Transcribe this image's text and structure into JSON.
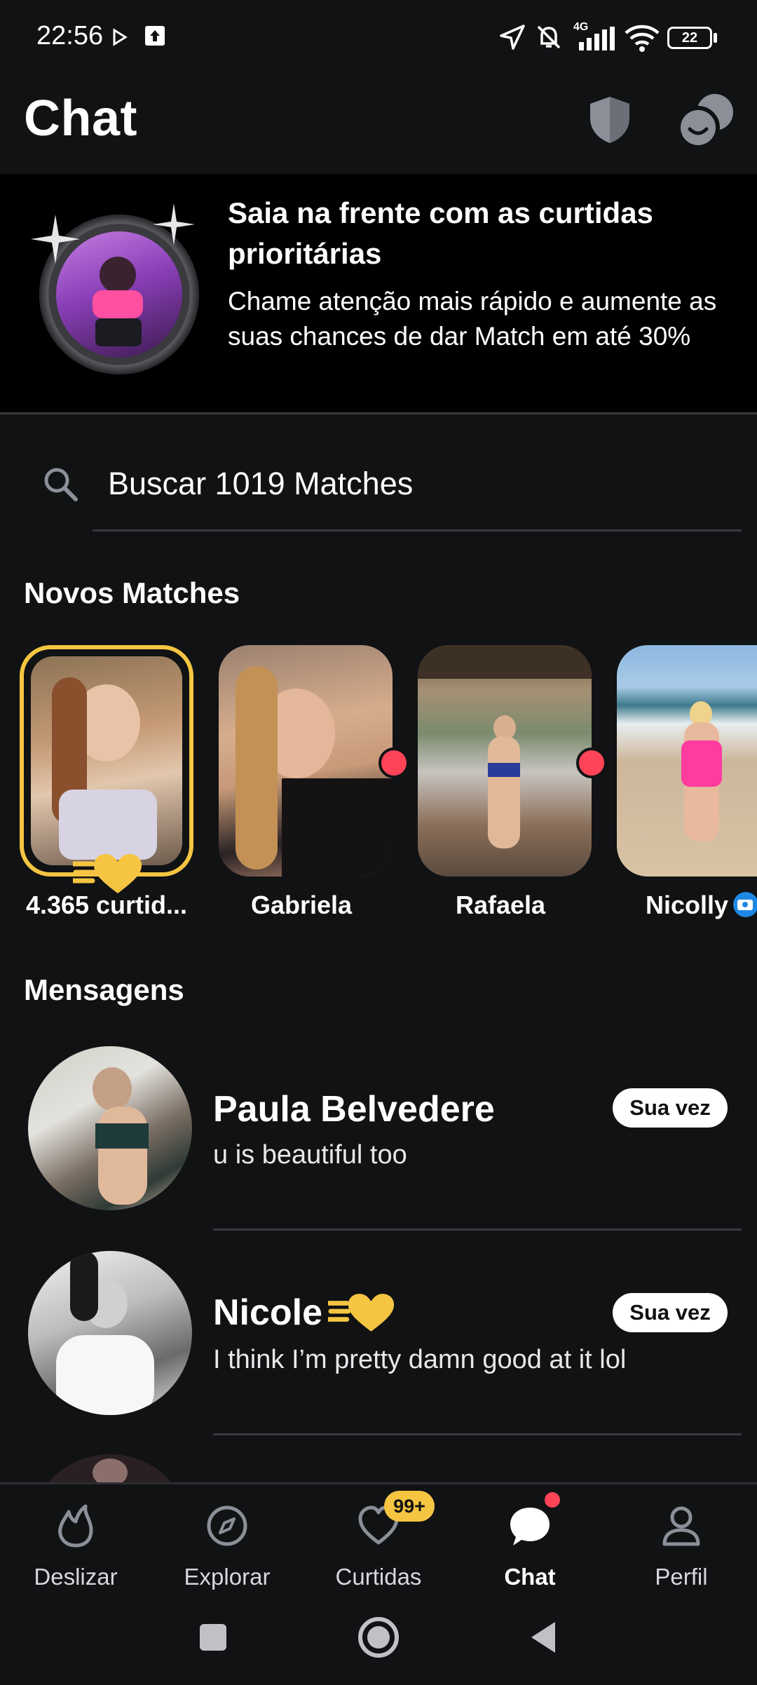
{
  "status_bar": {
    "time": "22:56",
    "battery": "22",
    "network": "4G",
    "icons": [
      "play-icon",
      "upload-icon",
      "location-icon",
      "bell-off-icon",
      "signal-icon",
      "wifi-icon",
      "battery-icon"
    ]
  },
  "header": {
    "title": "Chat",
    "icons": [
      "shield-icon",
      "chat-bubbles-icon"
    ]
  },
  "promo": {
    "title": "Saia na frente com as curtidas prioritárias",
    "body": "Chame atenção mais rápido e aumente as suas chances de dar Match em até 30%"
  },
  "search": {
    "placeholder": "Buscar 1019 Matches"
  },
  "new_matches": {
    "title": "Novos Matches",
    "items": [
      {
        "label": "4.365 curtid...",
        "kind": "likes"
      },
      {
        "label": "Gabriela",
        "online": true
      },
      {
        "label": "Rafaela",
        "online": true
      },
      {
        "label": "Nicolly",
        "verified_photo": true
      }
    ]
  },
  "messages": {
    "title": "Mensagens",
    "items": [
      {
        "name": "Paula Belvedere",
        "text": "u is beautiful too",
        "badge": "Sua vez"
      },
      {
        "name": "Nicole",
        "text": "I think I’m pretty damn good at it lol",
        "badge": "Sua vez"
      }
    ]
  },
  "bottom_nav": {
    "items": [
      {
        "label": "Deslizar",
        "icon": "flame-icon"
      },
      {
        "label": "Explorar",
        "icon": "compass-icon"
      },
      {
        "label": "Curtidas",
        "icon": "heart-icon",
        "badge": "99+"
      },
      {
        "label": "Chat",
        "icon": "chat-icon",
        "active": true
      },
      {
        "label": "Perfil",
        "icon": "person-icon"
      }
    ]
  },
  "colors": {
    "background": "#111214",
    "accent_gold": "#f5c542",
    "online_red": "#ff4458",
    "divider": "#3a3b40"
  }
}
